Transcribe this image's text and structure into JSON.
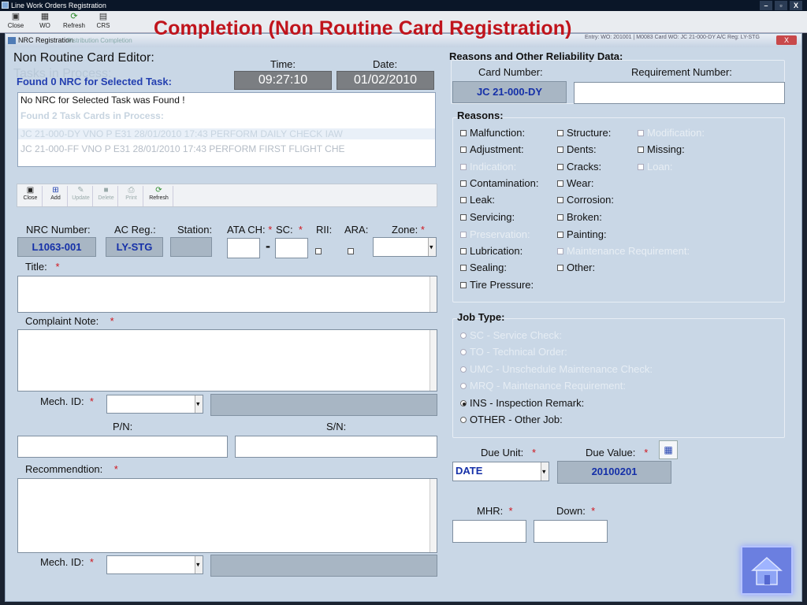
{
  "window": {
    "title": "Line Work Orders Registration",
    "controls": [
      "–",
      "▫",
      "X"
    ]
  },
  "toolbar": {
    "items": [
      {
        "label": "Close",
        "icon": "close-doc-icon"
      },
      {
        "label": "WO",
        "icon": "wo-icon"
      },
      {
        "label": "Refresh",
        "icon": "refresh-icon"
      },
      {
        "label": "CRS",
        "icon": "crs-icon"
      }
    ]
  },
  "headline": "Completion (Non Routine Card Registration)",
  "dialog": {
    "title": "NRC Registration",
    "ghost_tabs": "Distribution   Completion",
    "faded_header": "Entry: WO: 201001 | M0083  Card WO: JC 21-000-DY  A/C Reg: LY-STG",
    "close": "X"
  },
  "editor": {
    "title": "Non Routine Card Editor:",
    "time_label": "Time:",
    "date_label": "Date:",
    "time_value": "09:27:10",
    "date_value": "01/02/2010",
    "found_nrc": "Found 0 NRC for Selected Task:",
    "no_nrc_msg": "No NRC for Selected Task was Found !",
    "ghost_tasks_title": "Tasks in Process:",
    "ghost_found": "Found 2 Task Cards in Process:",
    "ghost_rows": [
      "JC 21-000-DY    VNO    P          E31    28/01/2010    17:43    PERFORM DAILY CHECK IAW",
      "JC 21-000-FF    VNO    P          E31    28/01/2010    17:43    PERFORM FIRST FLIGHT CHE"
    ]
  },
  "subtoolbar": {
    "items": [
      {
        "label": "Close",
        "icon": "close-doc-icon",
        "enabled": true
      },
      {
        "label": "Add",
        "icon": "add-icon",
        "enabled": true
      },
      {
        "label": "Update",
        "icon": "update-icon",
        "enabled": false
      },
      {
        "label": "Delete",
        "icon": "delete-icon",
        "enabled": false
      },
      {
        "label": "Print",
        "icon": "print-icon",
        "enabled": false
      },
      {
        "label": "Refresh",
        "icon": "refresh-icon",
        "enabled": true
      }
    ]
  },
  "form": {
    "nrc_number_label": "NRC Number:",
    "nrc_number": "L1063-001",
    "ac_reg_label": "AC Reg.:",
    "ac_reg": "LY-STG",
    "station_label": "Station:",
    "station": "",
    "ata_ch_label": "ATA CH:",
    "sc_label": "SC:",
    "rii_label": "RII:",
    "ara_label": "ARA:",
    "zone_label": "Zone:",
    "dash": "-",
    "required": "*",
    "title_label": "Title:",
    "complaint_label": "Complaint Note:",
    "mech_id_label": "Mech. ID:",
    "pn_label": "P/N:",
    "sn_label": "S/N:",
    "recommendation_label": "Recommendtion:"
  },
  "reasons_panel": {
    "title": "Reasons and Other Reliability Data:",
    "card_number_label": "Card Number:",
    "card_number": "JC 21-000-DY",
    "requirement_label": "Requirement Number:",
    "reasons_title": "Reasons:",
    "col1": [
      {
        "label": "Malfunction:",
        "enabled": true
      },
      {
        "label": "Adjustment:",
        "enabled": true
      },
      {
        "label": "Indication:",
        "enabled": false
      },
      {
        "label": "Contamination:",
        "enabled": true
      },
      {
        "label": "Leak:",
        "enabled": true
      },
      {
        "label": "Servicing:",
        "enabled": true
      },
      {
        "label": "Preservation:",
        "enabled": false
      },
      {
        "label": "Lubrication:",
        "enabled": true
      },
      {
        "label": "Sealing:",
        "enabled": true
      },
      {
        "label": "Tire Pressure:",
        "enabled": true
      }
    ],
    "col2": [
      {
        "label": "Structure:",
        "enabled": true
      },
      {
        "label": "Dents:",
        "enabled": true
      },
      {
        "label": "Cracks:",
        "enabled": true
      },
      {
        "label": "Wear:",
        "enabled": true
      },
      {
        "label": "Corrosion:",
        "enabled": true
      },
      {
        "label": "Broken:",
        "enabled": true
      },
      {
        "label": "Painting:",
        "enabled": true
      },
      {
        "label": "Maintenance Requirement:",
        "enabled": false
      },
      {
        "label": "Other:",
        "enabled": true
      }
    ],
    "col3": [
      {
        "label": "Modification:",
        "enabled": false
      },
      {
        "label": "Missing:",
        "enabled": true
      },
      {
        "label": "Loan:",
        "enabled": false
      }
    ]
  },
  "job_type": {
    "title": "Job Type:",
    "options": [
      {
        "label": "SC - Service Check:",
        "enabled": false,
        "selected": false
      },
      {
        "label": "TO - Technical Order:",
        "enabled": false,
        "selected": false
      },
      {
        "label": "UMC - Unschedule Maintenance Check:",
        "enabled": false,
        "selected": false
      },
      {
        "label": "MRQ - Maintenance Requirement:",
        "enabled": false,
        "selected": false
      },
      {
        "label": "INS - Inspection Remark:",
        "enabled": true,
        "selected": true
      },
      {
        "label": "OTHER - Other Job:",
        "enabled": true,
        "selected": false
      }
    ]
  },
  "due": {
    "unit_label": "Due Unit:",
    "unit_value": "DATE",
    "value_label": "Due Value:",
    "value": "20100201",
    "mhr_label": "MHR:",
    "down_label": "Down:"
  },
  "colors": {
    "headline": "#c0141c",
    "accent_blue": "#1530a8",
    "panel_bg": "#c9d7e6"
  }
}
